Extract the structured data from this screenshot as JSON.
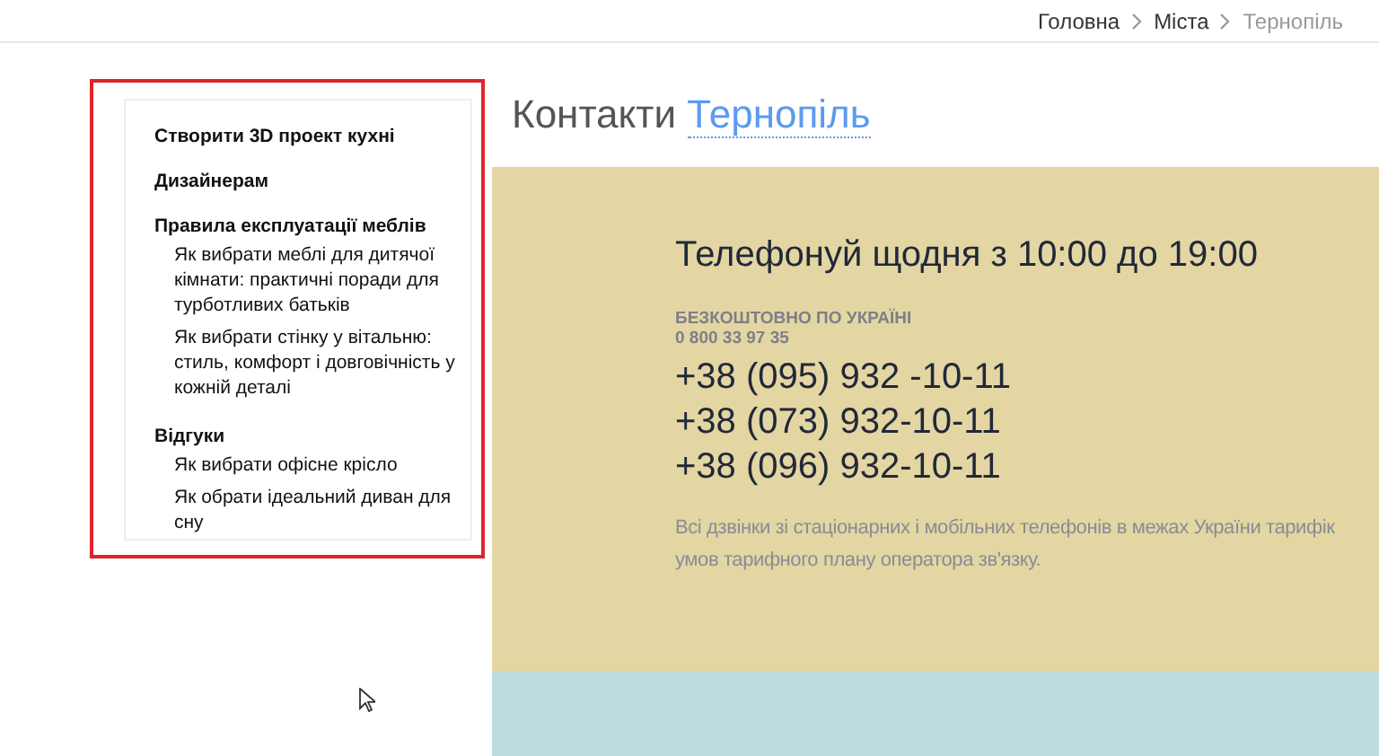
{
  "breadcrumbs": [
    {
      "label": "Головна",
      "current": false
    },
    {
      "label": "Міста",
      "current": false
    },
    {
      "label": "Тернопіль",
      "current": true
    }
  ],
  "sidebar": {
    "highlighted": true,
    "groups": [
      {
        "title": "Створити 3D проект кухні"
      },
      {
        "title": "Дизайнерам"
      },
      {
        "title": "Правила експлуатації меблів",
        "children": [
          {
            "title": "Як вибрати меблі для дитячої кімнати: практичні поради для турботливих батьків"
          },
          {
            "title": "Як вибрати стінку у вітальню: стиль, комфорт і довговічність у кожній деталі"
          }
        ]
      },
      {
        "title": "Відгуки",
        "children": [
          {
            "title": "Як вибрати офісне крісло"
          },
          {
            "title": "Як обрати ідеальний диван для сну"
          }
        ]
      }
    ]
  },
  "heading": {
    "text": "Контакти",
    "city": "Тернопіль"
  },
  "contacts": {
    "title": "Телефонуй щодня з 10:00 до 19:00",
    "free_label": "БЕЗКОШТОВНО ПО УКРАЇНІ",
    "free_number": "0 800 33 97 35",
    "phones": [
      "+38 (095) 932 -10-11",
      "+38 (073) 932-10-11",
      "+38 (096) 932-10-11"
    ],
    "note_lines": [
      "Всі дзвінки зі стаціонарних і мобільних телефонів в межах України тарифік",
      "умов тарифного плану оператора зв'язку."
    ]
  }
}
